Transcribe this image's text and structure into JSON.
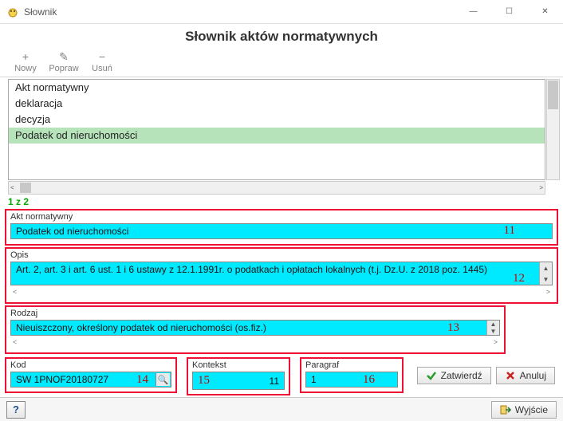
{
  "window": {
    "title": "Słownik",
    "min": "—",
    "max": "☐",
    "close": "✕"
  },
  "header": "Słownik aktów normatywnych",
  "toolbar": {
    "nowy": {
      "label": "Nowy",
      "icon": "+"
    },
    "popraw": {
      "label": "Popraw",
      "icon": "✎"
    },
    "usun": {
      "label": "Usuń",
      "icon": "−"
    }
  },
  "list": {
    "items": [
      {
        "label": "Akt normatywny"
      },
      {
        "label": "deklaracja"
      },
      {
        "label": "decyzja"
      },
      {
        "label": "Podatek od nieruchomości",
        "selected": true,
        "star": true
      }
    ]
  },
  "counter": "1 z 2",
  "fields": {
    "akt": {
      "label": "Akt normatywny",
      "value": "Podatek od nieruchomości",
      "tag": "11"
    },
    "opis": {
      "label": "Opis",
      "value": "Art. 2, art. 3 i art. 6 ust. 1 i 6 ustawy z 12.1.1991r. o podatkach i opłatach lokalnych (t.j. Dz.U. z 2018 poz. 1445)",
      "tag": "12"
    },
    "rodzaj": {
      "label": "Rodzaj",
      "value": "Nieuiszczony, określony podatek od nieruchomości (os.fiz.)",
      "tag": "13"
    },
    "kod": {
      "label": "Kod",
      "value": "SW 1PNOF20180727",
      "tag": "14"
    },
    "kontekst": {
      "label": "Kontekst",
      "value": "11",
      "tag": "15"
    },
    "paragraf": {
      "label": "Paragraf",
      "value": "1",
      "tag": "16"
    }
  },
  "buttons": {
    "zatwierdz": "Zatwierdź",
    "anuluj": "Anuluj",
    "wyjscie": "Wyjście",
    "help": "?"
  },
  "scroll": {
    "left": "<",
    "right": ">"
  }
}
